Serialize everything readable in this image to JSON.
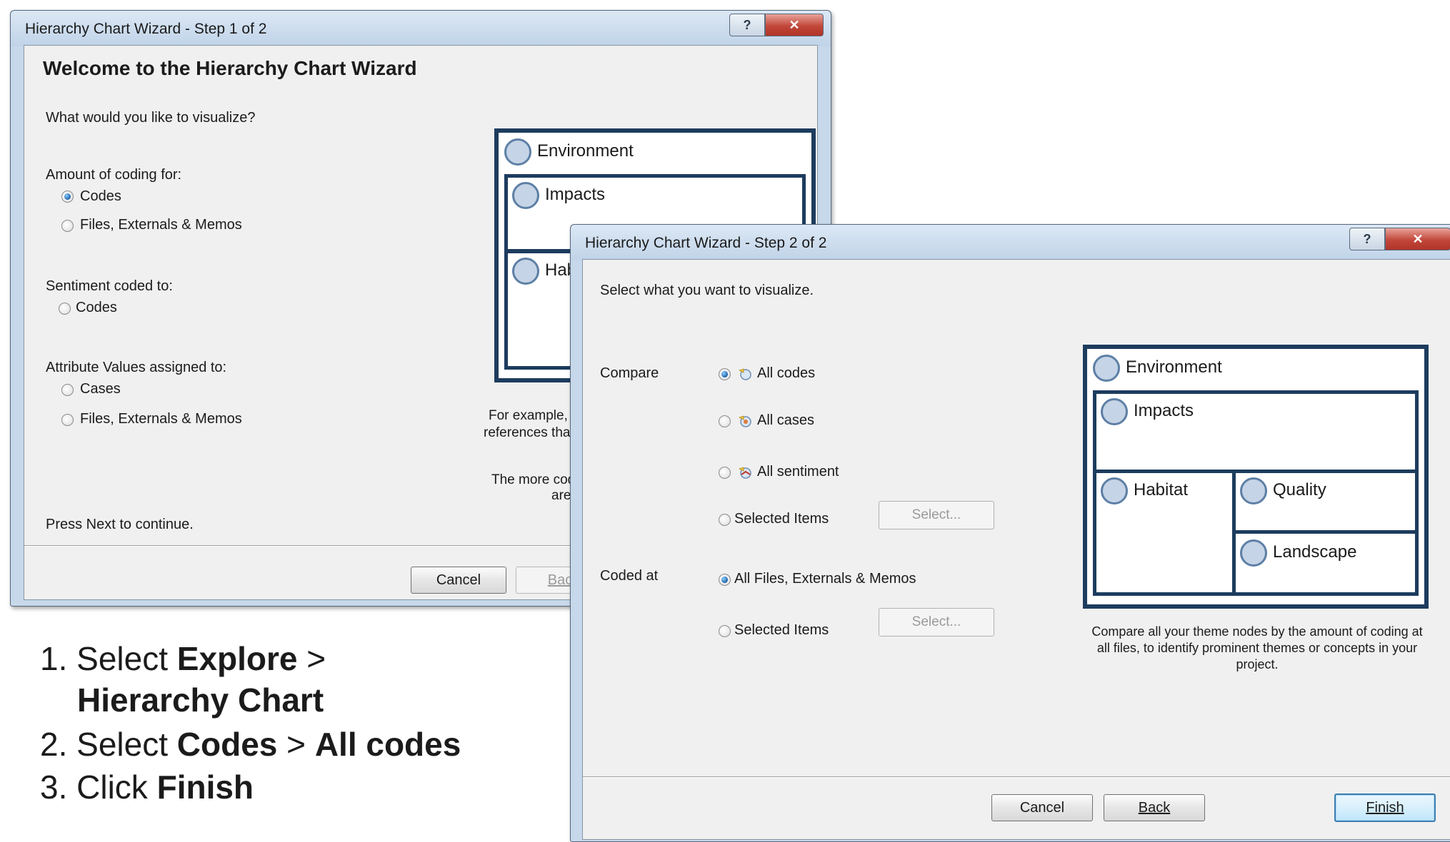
{
  "window1": {
    "title": "Hierarchy Chart Wizard - Step 1 of 2",
    "heading": "Welcome to the Hierarchy Chart Wizard",
    "question": "What would you like to visualize?",
    "amount_label": "Amount of coding for:",
    "amount_options": [
      "Codes",
      "Files, Externals & Memos"
    ],
    "sentiment_label": "Sentiment coded to:",
    "sentiment_option": "Codes",
    "attribute_label": "Attribute Values assigned to:",
    "attribute_options": [
      "Cases",
      "Files, Externals & Memos"
    ],
    "example_text": "For example, s",
    "references_text": "references thar",
    "more_text": "The more cod",
    "are_text": "are",
    "press_next": "Press Next to continue.",
    "cancel": "Cancel",
    "back": "Back",
    "preview": {
      "environment": "Environment",
      "impacts": "Impacts",
      "habitat": "Hab"
    }
  },
  "window2": {
    "title": "Hierarchy Chart Wizard - Step 2 of 2",
    "instruction": "Select what you want to visualize.",
    "compare_label": "Compare",
    "compare_options": [
      "All codes",
      "All cases",
      "All sentiment",
      "Selected Items"
    ],
    "coded_at_label": "Coded at",
    "coded_options": [
      "All Files, Externals & Memos",
      "Selected Items"
    ],
    "select_label": "Select...",
    "preview": {
      "environment": "Environment",
      "impacts": "Impacts",
      "habitat": "Habitat",
      "quality": "Quality",
      "landscape": "Landscape"
    },
    "caption": "Compare all your theme nodes by the amount of coding at all files, to identify prominent themes or concepts in your project.",
    "cancel": "Cancel",
    "back": "Back",
    "finish": "Finish"
  },
  "help_glyph": "?",
  "close_glyph": "✕",
  "instructions": {
    "s1_num": "1. Select ",
    "s1_bold": "Explore",
    "s1_sep": " >",
    "s1_line2": "Hierarchy Chart",
    "s2_num": "2. Select ",
    "s2_bold1": "Codes",
    "s2_sep": " > ",
    "s2_bold2": "All codes",
    "s3_num": "3. Click ",
    "s3_bold": "Finish"
  },
  "colors": {
    "accent_dark": "#1d3c5e",
    "node_fill": "#c5d4e6",
    "close_red": "#c2473a"
  }
}
